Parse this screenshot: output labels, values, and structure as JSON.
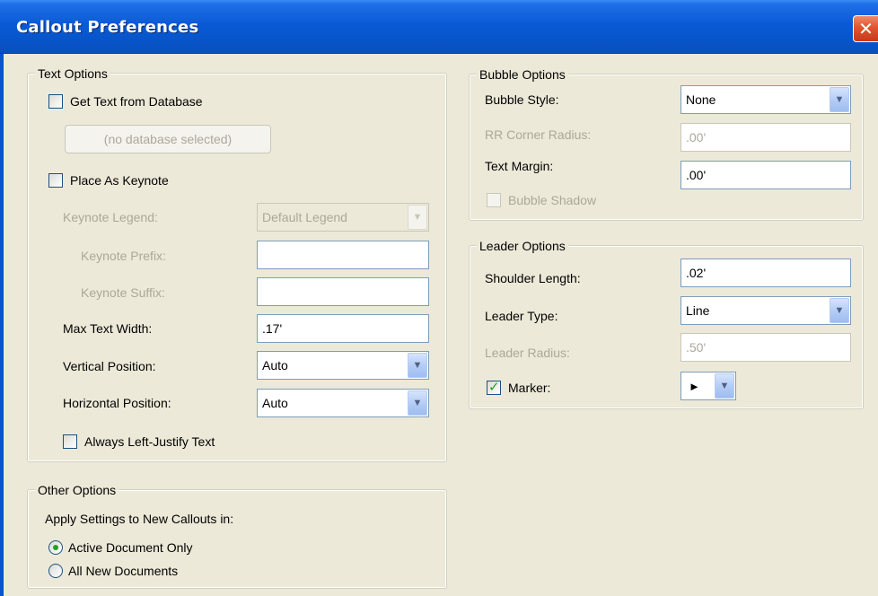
{
  "window": {
    "title": "Callout Preferences",
    "close_glyph": "✕"
  },
  "text_options": {
    "legend": "Text Options",
    "get_text_from_database": {
      "label": "Get Text from Database",
      "checked": false
    },
    "database_button": "(no database selected)",
    "place_as_keynote": {
      "label": "Place As Keynote",
      "checked": false
    },
    "keynote_legend": {
      "label": "Keynote Legend:",
      "value": "Default Legend"
    },
    "keynote_prefix": {
      "label": "Keynote Prefix:",
      "value": ""
    },
    "keynote_suffix": {
      "label": "Keynote Suffix:",
      "value": ""
    },
    "max_text_width": {
      "label": "Max Text Width:",
      "value": ".17'"
    },
    "vertical_position": {
      "label": "Vertical Position:",
      "value": "Auto"
    },
    "horizontal_position": {
      "label": "Horizontal Position:",
      "value": "Auto"
    },
    "always_left_justify": {
      "label": "Always Left-Justify Text",
      "checked": false
    }
  },
  "other_options": {
    "legend": "Other Options",
    "apply_label": "Apply Settings to New Callouts in:",
    "active_document_only": {
      "label": "Active Document Only",
      "selected": true
    },
    "all_new_documents": {
      "label": "All New Documents",
      "selected": false
    }
  },
  "bubble_options": {
    "legend": "Bubble Options",
    "bubble_style": {
      "label": "Bubble Style:",
      "value": "None"
    },
    "rr_corner_radius": {
      "label": "RR Corner Radius:",
      "value": ".00'"
    },
    "text_margin": {
      "label": "Text Margin:",
      "value": ".00'"
    },
    "bubble_shadow": {
      "label": "Bubble Shadow",
      "checked": false
    }
  },
  "leader_options": {
    "legend": "Leader Options",
    "shoulder_length": {
      "label": "Shoulder Length:",
      "value": ".02'"
    },
    "leader_type": {
      "label": "Leader Type:",
      "value": "Line"
    },
    "leader_radius": {
      "label": "Leader Radius:",
      "value": ".50'"
    },
    "marker": {
      "label": "Marker:",
      "checked": true,
      "value_glyph": "►"
    }
  },
  "icons": {
    "dropdown": "chevron-down-icon",
    "check": "check-icon",
    "close": "close-icon"
  },
  "colors": {
    "titlebar": "#0756cc",
    "dialog_bg": "#ece9d8",
    "disabled_text": "#aca899",
    "check_green": "#21a121"
  }
}
